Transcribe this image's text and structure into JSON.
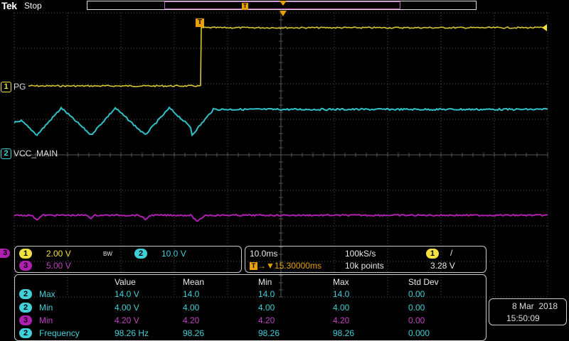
{
  "header": {
    "brand": "Tek",
    "acq_state": "Stop",
    "record_marker": "T"
  },
  "colors": {
    "ch1": "#f0e040",
    "ch2": "#40d0d8",
    "ch3": "#b020b0",
    "trigger": "#e8a000"
  },
  "channels": {
    "ch1": {
      "num": "1",
      "label": "PG"
    },
    "ch2": {
      "num": "2",
      "label": "VCC_MAIN"
    },
    "ch3": {
      "num": "3"
    }
  },
  "trigger_marker": "T",
  "vertical": {
    "ch1_num": "1",
    "ch1_scale": "2.00 V",
    "bw_flag": "BW",
    "ch2_num": "2",
    "ch2_scale": "10.0 V",
    "ch3_num": "3",
    "ch3_scale": "5.00 V"
  },
  "horizontal": {
    "timebase": "10.0ms",
    "sample_rate": "100kS/s",
    "trig_pos_icon": "T",
    "trig_pos": "15.30000ms",
    "record_length": "10k points",
    "trig_source": "1",
    "trig_slope": "/",
    "trig_level": "3.28 V"
  },
  "measurements": {
    "headers": [
      "Value",
      "Mean",
      "Min",
      "Max",
      "Std Dev"
    ],
    "rows": [
      {
        "ch": "2",
        "name": "Max",
        "value": "14.0 V",
        "mean": "14.0",
        "min": "14.0",
        "max": "14.0",
        "std": "0.00"
      },
      {
        "ch": "2",
        "name": "Min",
        "value": "4.00 V",
        "mean": "4.00",
        "min": "4.00",
        "max": "4.00",
        "std": "0.00"
      },
      {
        "ch": "3",
        "name": "Min",
        "value": "4.20 V",
        "mean": "4.20",
        "min": "4.20",
        "max": "4.20",
        "std": "0.00"
      },
      {
        "ch": "2",
        "name": "Frequency",
        "value": "98.26 Hz",
        "mean": "98.26",
        "min": "98.26",
        "max": "98.26",
        "std": "0.000"
      }
    ]
  },
  "datetime": {
    "date": "8 Mar  2018",
    "time": "15:50:09"
  }
}
